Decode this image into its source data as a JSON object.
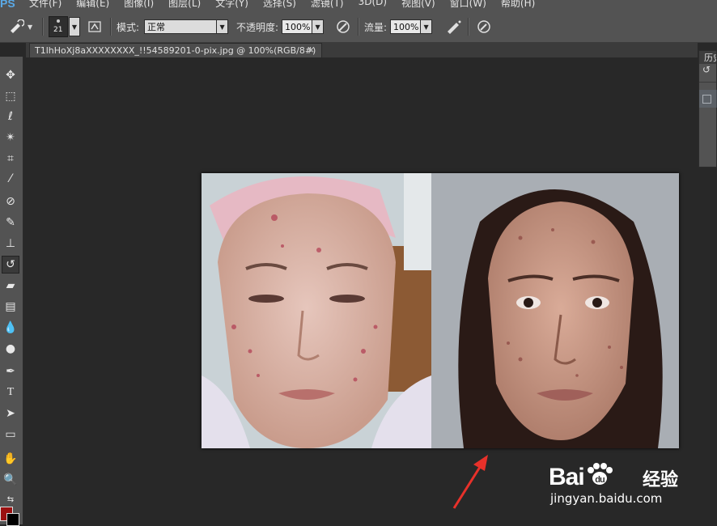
{
  "app": {
    "logo": "PS"
  },
  "menu": [
    "文件(F)",
    "编辑(E)",
    "图像(I)",
    "图层(L)",
    "文字(Y)",
    "选择(S)",
    "滤镜(T)",
    "3D(D)",
    "视图(V)",
    "窗口(W)",
    "帮助(H)"
  ],
  "options": {
    "brush_size": "21",
    "mode_label": "模式:",
    "mode_value": "正常",
    "opacity_label": "不透明度:",
    "opacity_value": "100%",
    "flow_label": "流量:",
    "flow_value": "100%"
  },
  "document": {
    "tab_title": "T1lhHoXj8aXXXXXXXX_!!54589201-0-pix.jpg @ 100%(RGB/8#)",
    "close": "×"
  },
  "panel": {
    "title": "历史"
  },
  "tools": [
    "move-tool",
    "marquee-tool",
    "lasso-tool",
    "magic-wand-tool",
    "crop-tool",
    "eyedropper-tool",
    "healing-brush-tool",
    "brush-tool",
    "clone-stamp-tool",
    "history-brush-tool",
    "eraser-tool",
    "gradient-tool",
    "blur-tool",
    "dodge-tool",
    "pen-tool",
    "type-tool",
    "path-selection-tool",
    "rectangle-tool",
    "hand-tool",
    "zoom-tool"
  ],
  "colors": {
    "foreground": "#9b1010",
    "background": "#000000",
    "accent": "#5aa9e6"
  },
  "watermark": {
    "brand": "Bai",
    "brand2": "du",
    "cn": "经验",
    "url": "jingyan.baidu.com"
  }
}
